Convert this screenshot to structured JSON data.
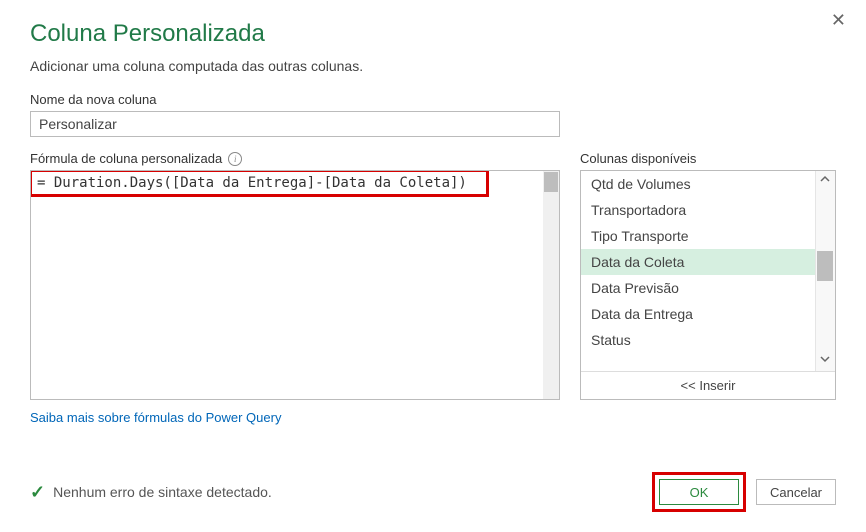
{
  "title": "Coluna Personalizada",
  "subtitle": "Adicionar uma coluna computada das outras colunas.",
  "labels": {
    "column_name": "Nome da nova coluna",
    "formula": "Fórmula de coluna personalizada",
    "available": "Colunas disponíveis"
  },
  "inputs": {
    "column_name_value": "Personalizar",
    "formula_value": "= Duration.Days([Data da Entrega]-[Data da Coleta])"
  },
  "available_columns": {
    "items": [
      "Qtd de Volumes",
      "Transportadora",
      "Tipo Transporte",
      "Data da Coleta",
      "Data Previsão",
      "Data da Entrega",
      "Status"
    ],
    "selected_index": 3
  },
  "buttons": {
    "insert": "<< Inserir",
    "ok": "OK",
    "cancel": "Cancelar"
  },
  "learn_more": "Saiba mais sobre fórmulas do Power Query",
  "status_text": "Nenhum erro de sintaxe detectado."
}
